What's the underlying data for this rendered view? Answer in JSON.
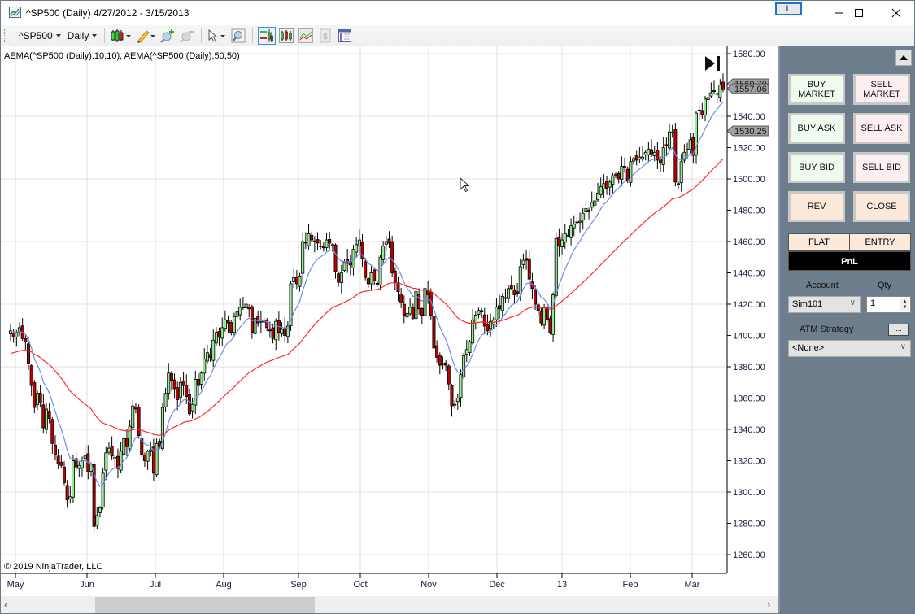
{
  "window": {
    "title": "^SP500 (Daily)  4/27/2012 - 3/15/2013",
    "link_button": "L",
    "minimize_icon": "minimize-icon",
    "maximize_icon": "maximize-icon",
    "close_icon": "close-icon"
  },
  "toolbar": {
    "instrument": "^SP500",
    "interval": "Daily",
    "icons": [
      "bar-type-icon",
      "drawing-tool-icon",
      "zoom-in-icon",
      "zoom-out-icon",
      "pointer-icon",
      "data-box-icon",
      "chart-trader-icon",
      "indicators-icon",
      "strategies-icon",
      "performance-icon",
      "properties-icon"
    ]
  },
  "chart": {
    "indicator_label": "AEMA(^SP500 (Daily),10,10), AEMA(^SP500 (Daily),50,50)",
    "copyright": "© 2019 NinjaTrader, LLC",
    "price_markers": [
      {
        "value": "1560.70",
        "color": "#a0a0a0"
      },
      {
        "value": "1557.06",
        "color": "#a0a0a0"
      },
      {
        "value": "1530.25",
        "color": "#a0a0a0"
      }
    ],
    "colors": {
      "up_candle": "#90ee90",
      "down_candle": "#c00000",
      "fast_ema": "#6b8fe8",
      "slow_ema": "#ff2b2b"
    }
  },
  "chart_data": {
    "type": "candlestick",
    "title": "^SP500 (Daily) 4/27/2012 - 3/15/2013",
    "ylim": [
      1250,
      1585
    ],
    "y_ticks": [
      "1580.00",
      "1560.00",
      "1540.00",
      "1520.00",
      "1500.00",
      "1480.00",
      "1460.00",
      "1440.00",
      "1420.00",
      "1400.00",
      "1380.00",
      "1360.00",
      "1340.00",
      "1320.00",
      "1300.00",
      "1280.00",
      "1260.00"
    ],
    "x_ticks": [
      "May",
      "Jun",
      "Jul",
      "Aug",
      "Sep",
      "Oct",
      "Nov",
      "Dec",
      "13",
      "Feb",
      "Mar"
    ],
    "grid": true,
    "series": [
      {
        "name": "AEMA(^SP500 (Daily),10,10)",
        "type": "line"
      },
      {
        "name": "AEMA(^SP500 (Daily),50,50)",
        "type": "line"
      }
    ],
    "closes": [
      1403,
      1399,
      1402,
      1405,
      1398,
      1396,
      1382,
      1368,
      1354,
      1363,
      1357,
      1341,
      1353,
      1347,
      1331,
      1324,
      1318,
      1317,
      1306,
      1295,
      1297,
      1320,
      1316,
      1317,
      1320,
      1323,
      1313,
      1318,
      1278,
      1285,
      1290,
      1312,
      1325,
      1328,
      1323,
      1322,
      1315,
      1326,
      1334,
      1329,
      1342,
      1355,
      1353,
      1336,
      1324,
      1320,
      1326,
      1327,
      1312,
      1331,
      1329,
      1354,
      1363,
      1376,
      1371,
      1366,
      1359,
      1370,
      1368,
      1361,
      1350,
      1356,
      1372,
      1368,
      1376,
      1385,
      1389,
      1386,
      1397,
      1402,
      1399,
      1405,
      1410,
      1408,
      1402,
      1412,
      1415,
      1418,
      1418,
      1420,
      1417,
      1402,
      1411,
      1408,
      1409,
      1410,
      1405,
      1403,
      1398,
      1409,
      1402,
      1404,
      1400,
      1406,
      1433,
      1437,
      1433,
      1438,
      1460,
      1459,
      1465,
      1461,
      1460,
      1459,
      1457,
      1456,
      1461,
      1459,
      1458,
      1441,
      1434,
      1440,
      1447,
      1446,
      1445,
      1455,
      1458,
      1461,
      1449,
      1437,
      1433,
      1440,
      1435,
      1433,
      1450,
      1457,
      1460,
      1459,
      1440,
      1434,
      1428,
      1421,
      1413,
      1414,
      1418,
      1411,
      1428,
      1417,
      1413,
      1430,
      1426,
      1413,
      1392,
      1386,
      1381,
      1382,
      1381,
      1369,
      1355,
      1356,
      1360,
      1375,
      1387,
      1391,
      1396,
      1410,
      1413,
      1416,
      1415,
      1406,
      1403,
      1409,
      1410,
      1418,
      1417,
      1425,
      1424,
      1430,
      1430,
      1426,
      1427,
      1444,
      1448,
      1448,
      1436,
      1430,
      1420,
      1416,
      1408,
      1418,
      1410,
      1402,
      1426,
      1462,
      1457,
      1461,
      1465,
      1464,
      1470,
      1471,
      1472,
      1473,
      1478,
      1481,
      1480,
      1485,
      1486,
      1491,
      1495,
      1497,
      1494,
      1498,
      1502,
      1503,
      1500,
      1508,
      1507,
      1499,
      1511,
      1513,
      1512,
      1514,
      1514,
      1517,
      1519,
      1516,
      1517,
      1512,
      1510,
      1520,
      1521,
      1530,
      1530,
      1498,
      1497,
      1511,
      1517,
      1519,
      1525,
      1515,
      1542,
      1544,
      1541,
      1551,
      1552,
      1555,
      1556,
      1554,
      1560,
      1557
    ]
  },
  "panel": {
    "buttons": [
      {
        "label": "BUY\nMARKET",
        "kind": "buy"
      },
      {
        "label": "SELL\nMARKET",
        "kind": "sell"
      },
      {
        "label": "BUY ASK",
        "kind": "buy"
      },
      {
        "label": "SELL ASK",
        "kind": "sell"
      },
      {
        "label": "BUY BID",
        "kind": "buy"
      },
      {
        "label": "SELL BID",
        "kind": "sell"
      },
      {
        "label": "REV",
        "kind": "neutral"
      },
      {
        "label": "CLOSE",
        "kind": "neutral"
      }
    ],
    "flat_label": "FLAT",
    "entry_label": "ENTRY",
    "pnl_label": "PnL",
    "account_label": "Account",
    "account_value": "Sim101",
    "qty_label": "Qty",
    "qty_value": "1",
    "atm_label": "ATM Strategy",
    "atm_more": "...",
    "atm_value": "<None>"
  }
}
